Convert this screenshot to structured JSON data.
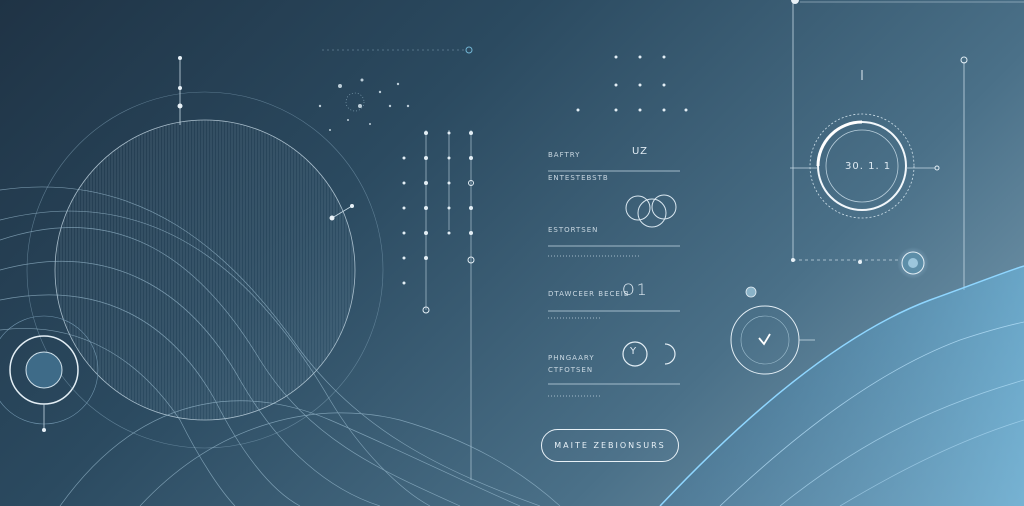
{
  "panel": {
    "row1_label": "BAFTRY",
    "row1_sub": "ENTESTEBSTB",
    "row1_value": "UZ",
    "row2_label": "ESTORTSEN",
    "row3_label": "DTAWCEER BECEIB",
    "row3_value": "O1",
    "row4_label_a": "PHNGAARY",
    "row4_label_b": "CTFOTSEN",
    "row4_value": "Y",
    "button_label": "MAITE ZEBIONSURS"
  },
  "gauge": {
    "readout": "30. 1. 1"
  },
  "icons": {
    "check": "check-icon"
  }
}
